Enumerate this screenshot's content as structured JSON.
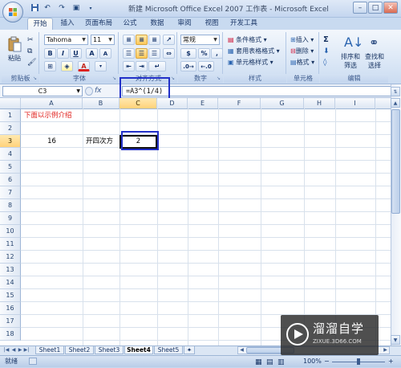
{
  "window": {
    "title": "新建 Microsoft Office Excel 2007 工作表 - Microsoft Excel",
    "controls": [
      "–",
      "□",
      "✕"
    ]
  },
  "qat_icons": [
    "save-icon",
    "undo-icon",
    "redo-icon",
    "quick-print-icon"
  ],
  "tabs": [
    {
      "label": "开始",
      "active": true
    },
    {
      "label": "插入"
    },
    {
      "label": "页面布局"
    },
    {
      "label": "公式"
    },
    {
      "label": "数据"
    },
    {
      "label": "审阅"
    },
    {
      "label": "视图"
    },
    {
      "label": "开发工具"
    }
  ],
  "ribbon": {
    "clipboard": {
      "paste": "粘贴",
      "label": "剪贴板"
    },
    "font": {
      "name": "Tahoma",
      "size": "11",
      "bold": "B",
      "italic": "I",
      "underline": "U",
      "grow": "A",
      "shrink": "A",
      "font_color_glyph": "A",
      "label": "字体"
    },
    "alignment": {
      "label": "对齐方式"
    },
    "number": {
      "format": "常规",
      "percent": "%",
      "comma": ",",
      "label": "数字"
    },
    "styles": {
      "conditional": "条件格式",
      "table": "套用表格格式",
      "cell_styles": "单元格样式",
      "label": "样式"
    },
    "cells": {
      "insert": "插入",
      "delete": "删除",
      "format": "格式",
      "label": "单元格"
    },
    "editing": {
      "sum": "Σ",
      "sort_filter_1": "排序和",
      "sort_filter_2": "筛选",
      "find_1": "查找和",
      "find_2": "选择",
      "label": "编辑"
    }
  },
  "formula_bar": {
    "name_box": "C3",
    "fx": "fx",
    "formula": "=A3^(1/4)"
  },
  "grid": {
    "columns": [
      "A",
      "B",
      "C",
      "D",
      "E",
      "F",
      "G",
      "H",
      "I"
    ],
    "rows": [
      "1",
      "2",
      "3",
      "4",
      "5",
      "6",
      "7",
      "8",
      "9",
      "10",
      "11",
      "12",
      "13",
      "14",
      "15",
      "16",
      "17",
      "18"
    ],
    "selected_col": "C",
    "selected_row": "3",
    "cells": {
      "A1": "下面以示例介绍",
      "A3": "16",
      "B3": "开四次方",
      "C3": "2"
    },
    "accent_text_color": "#e0201c"
  },
  "sheet_tabs": [
    {
      "label": "Sheet1"
    },
    {
      "label": "Sheet2"
    },
    {
      "label": "Sheet3"
    },
    {
      "label": "Sheet4",
      "active": true
    },
    {
      "label": "Sheet5"
    }
  ],
  "status_bar": {
    "mode": "就绪",
    "zoom": "100%",
    "zoom_minus": "−",
    "zoom_plus": "+"
  },
  "watermark": {
    "brand": "溜溜自学",
    "url": "ZIXUE.3D66.COM"
  },
  "colors": {
    "highlight": "#2230c8",
    "ribbon_bg": "#dbe7f6",
    "selected_header": "#ffd27a"
  }
}
